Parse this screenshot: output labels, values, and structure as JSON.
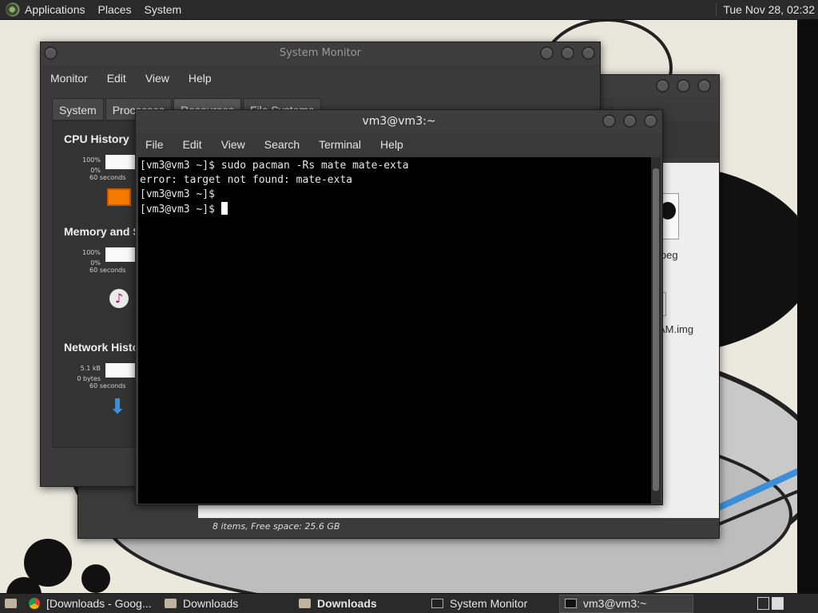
{
  "top_panel": {
    "menus": [
      "Applications",
      "Places",
      "System"
    ],
    "clock": "Tue Nov 28, 02:32"
  },
  "file_manager": {
    "files": [
      {
        "label": "jpeg"
      },
      {
        "label": "AM.img"
      }
    ],
    "status": "8 items, Free space: 25.6 GB"
  },
  "system_monitor": {
    "title": "System Monitor",
    "menus": [
      "Monitor",
      "Edit",
      "View",
      "Help"
    ],
    "tabs": [
      "System",
      "Processes",
      "Resources",
      "File Systems"
    ],
    "sections": {
      "cpu": {
        "title": "CPU History",
        "top": "100%",
        "bottom": "0%",
        "time": "60 seconds"
      },
      "memory": {
        "title": "Memory and Swap History",
        "top": "100%",
        "bottom": "0%",
        "time": "60 seconds"
      },
      "network": {
        "title": "Network History",
        "top": "5.1 kB",
        "bottom": "0 bytes",
        "time": "60 seconds"
      }
    },
    "colors": {
      "cpu": "#f47a00"
    }
  },
  "terminal": {
    "title": "vm3@vm3:~",
    "menus": [
      "File",
      "Edit",
      "View",
      "Search",
      "Terminal",
      "Help"
    ],
    "lines": [
      "[vm3@vm3 ~]$ sudo pacman -Rs mate mate-exta",
      "error: target not found: mate-exta",
      "[vm3@vm3 ~]$",
      "[vm3@vm3 ~]$ "
    ]
  },
  "taskbar": {
    "items": [
      {
        "label": "[Downloads - Goog...",
        "icon": "chrome-icon"
      },
      {
        "label": "Downloads",
        "icon": "folder-icon"
      },
      {
        "label": "Downloads",
        "icon": "folder-icon"
      },
      {
        "label": "System Monitor",
        "icon": "system-monitor-icon"
      },
      {
        "label": "vm3@vm3:~",
        "icon": "terminal-icon"
      }
    ]
  }
}
